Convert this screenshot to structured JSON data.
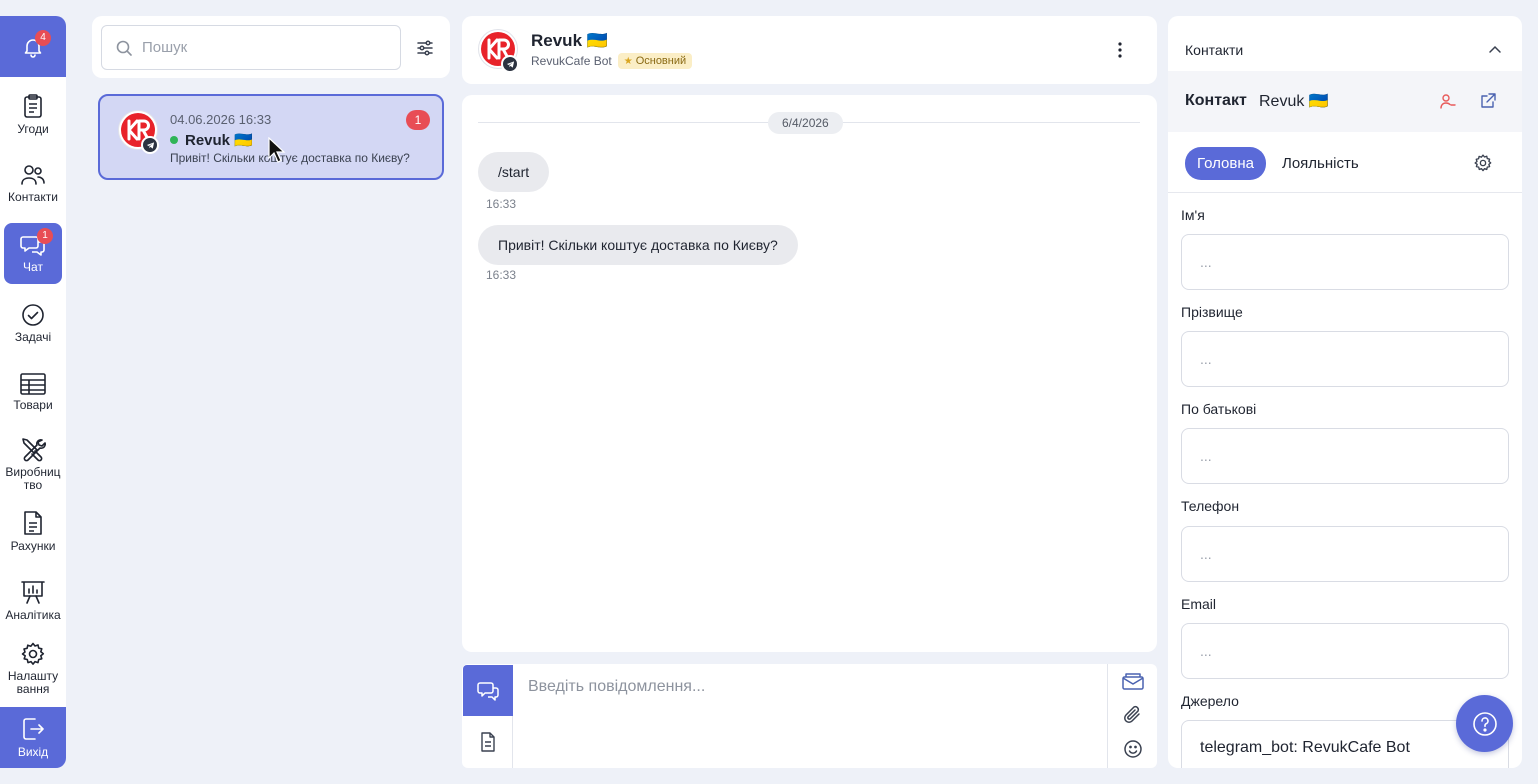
{
  "sidebar": {
    "notifications_count": "4",
    "items": [
      {
        "label": "Угоди"
      },
      {
        "label": "Контакти"
      },
      {
        "label": "Чат",
        "badge": "1"
      },
      {
        "label": "Задачі"
      },
      {
        "label": "Товари"
      },
      {
        "label": "Виробниц\nтво"
      },
      {
        "label": "Рахунки"
      },
      {
        "label": "Аналітика"
      },
      {
        "label": "Налашту\nвання"
      }
    ],
    "exit_label": "Вихід"
  },
  "search": {
    "placeholder": "Пошук"
  },
  "chat_list": [
    {
      "timestamp": "04.06.2026 16:33",
      "name": "Revuk 🇺🇦",
      "preview": "Привіт! Скільки коштує доставка по Києву?",
      "unread": "1",
      "online": true
    }
  ],
  "chat_header": {
    "name": "Revuk 🇺🇦",
    "bot_name": "RevukCafe Bot",
    "tag": "Основний"
  },
  "messages": {
    "date": "6/4/2026",
    "items": [
      {
        "text": "/start",
        "time": "16:33"
      },
      {
        "text": "Привіт! Скільки коштує доставка по Києву?",
        "time": "16:33"
      }
    ]
  },
  "composer": {
    "placeholder": "Введіть повідомлення..."
  },
  "contact_panel": {
    "title": "Контакти",
    "contact_label": "Контакт",
    "contact_name": "Revuk 🇺🇦",
    "tabs": [
      "Головна",
      "Лояльність"
    ],
    "fields": [
      {
        "label": "Ім'я",
        "value": "..."
      },
      {
        "label": "Прізвище",
        "value": "..."
      },
      {
        "label": "По батькові",
        "value": "..."
      },
      {
        "label": "Телефон",
        "value": "..."
      },
      {
        "label": "Email",
        "value": "..."
      },
      {
        "label": "Джерело",
        "value": "telegram_bot: RevukCafe Bot"
      }
    ]
  },
  "colors": {
    "accent": "#5a6ad8",
    "badge": "#e84d55",
    "online": "#2fb457",
    "tag_bg": "#fbeec6"
  }
}
